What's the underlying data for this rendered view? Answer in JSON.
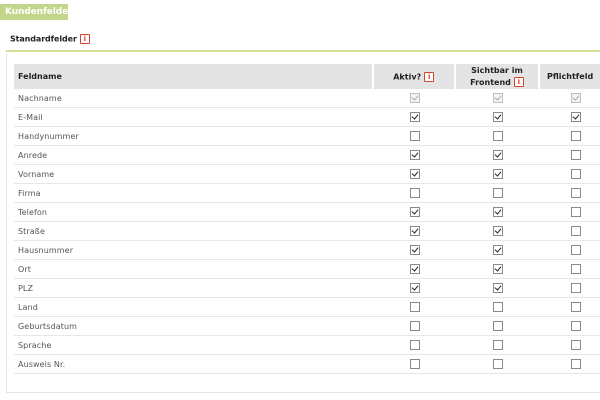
{
  "tab": {
    "label": "Kundenfelder"
  },
  "section": {
    "title": "Standardfelder",
    "info_icon": "i"
  },
  "table": {
    "columns": {
      "name": "Feldname",
      "aktiv": "Aktiv?",
      "sichtbar_line1": "Sichtbar im",
      "sichtbar_line2": "Frontend",
      "pflicht": "Pflichtfeld"
    },
    "rows": [
      {
        "name": "Nachname",
        "aktiv": true,
        "sichtbar": true,
        "pflicht": true,
        "disabled": true
      },
      {
        "name": "E-Mail",
        "aktiv": true,
        "sichtbar": true,
        "pflicht": true,
        "disabled": false
      },
      {
        "name": "Handynummer",
        "aktiv": false,
        "sichtbar": false,
        "pflicht": false,
        "disabled": false
      },
      {
        "name": "Anrede",
        "aktiv": true,
        "sichtbar": true,
        "pflicht": false,
        "disabled": false
      },
      {
        "name": "Vorname",
        "aktiv": true,
        "sichtbar": true,
        "pflicht": false,
        "disabled": false
      },
      {
        "name": "Firma",
        "aktiv": false,
        "sichtbar": false,
        "pflicht": false,
        "disabled": false
      },
      {
        "name": "Telefon",
        "aktiv": true,
        "sichtbar": true,
        "pflicht": false,
        "disabled": false
      },
      {
        "name": "Straße",
        "aktiv": true,
        "sichtbar": true,
        "pflicht": false,
        "disabled": false
      },
      {
        "name": "Hausnummer",
        "aktiv": true,
        "sichtbar": true,
        "pflicht": false,
        "disabled": false
      },
      {
        "name": "Ort",
        "aktiv": true,
        "sichtbar": true,
        "pflicht": false,
        "disabled": false
      },
      {
        "name": "PLZ",
        "aktiv": true,
        "sichtbar": true,
        "pflicht": false,
        "disabled": false
      },
      {
        "name": "Land",
        "aktiv": false,
        "sichtbar": false,
        "pflicht": false,
        "disabled": false
      },
      {
        "name": "Geburtsdatum",
        "aktiv": false,
        "sichtbar": false,
        "pflicht": false,
        "disabled": false
      },
      {
        "name": "Sprache",
        "aktiv": false,
        "sichtbar": false,
        "pflicht": false,
        "disabled": false
      },
      {
        "name": "Ausweis Nr.",
        "aktiv": false,
        "sichtbar": false,
        "pflicht": false,
        "disabled": false
      }
    ]
  },
  "colors": {
    "tab_bg": "#c2d58a",
    "rule": "#d6e29c",
    "header_bg": "#e4e4e4",
    "info": "#d3452e"
  }
}
